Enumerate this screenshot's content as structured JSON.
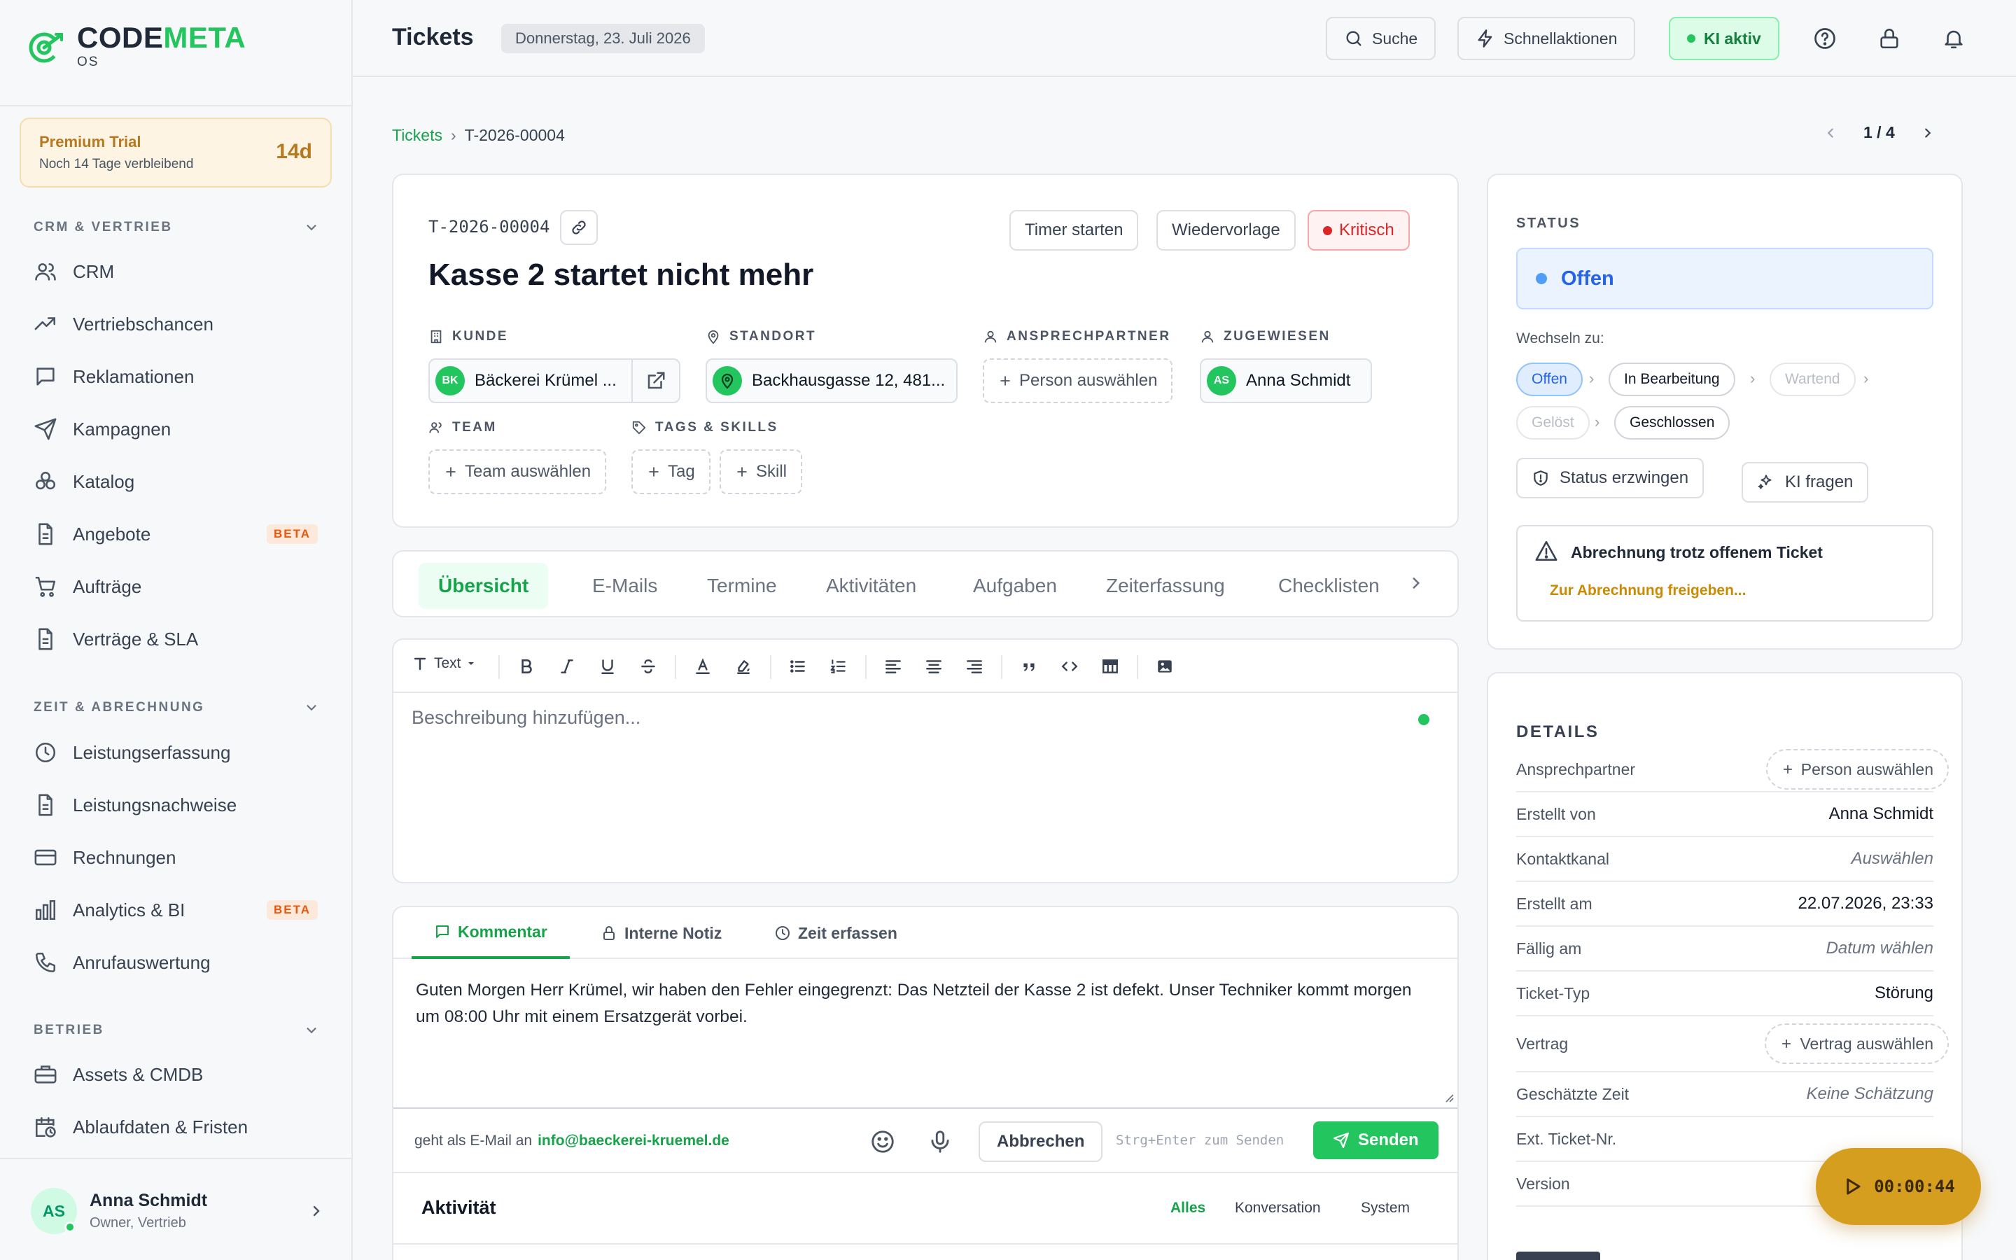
{
  "brand": {
    "name_a": "CODE",
    "name_b": "META",
    "sub": "OS"
  },
  "trial": {
    "title": "Premium Trial",
    "subtitle": "Noch 14 Tage verbleibend",
    "days": "14d"
  },
  "sidebar": {
    "sections": [
      {
        "label": "CRM & VERTRIEB"
      },
      {
        "label": "ZEIT & ABRECHNUNG"
      },
      {
        "label": "BETRIEB"
      }
    ],
    "items": [
      {
        "label": "CRM",
        "icon": "users-icon"
      },
      {
        "label": "Vertriebschancen",
        "icon": "trending-up-icon"
      },
      {
        "label": "Reklamationen",
        "icon": "message-square-icon"
      },
      {
        "label": "Kampagnen",
        "icon": "send-icon"
      },
      {
        "label": "Katalog",
        "icon": "boxes-icon"
      },
      {
        "label": "Angebote",
        "icon": "file-text-icon",
        "badge": "BETA"
      },
      {
        "label": "Aufträge",
        "icon": "cart-icon"
      },
      {
        "label": "Verträge & SLA",
        "icon": "file-text-icon"
      },
      {
        "label": "Leistungserfassung",
        "icon": "clock-icon"
      },
      {
        "label": "Leistungsnachweise",
        "icon": "file-text-icon"
      },
      {
        "label": "Rechnungen",
        "icon": "credit-card-icon"
      },
      {
        "label": "Analytics & BI",
        "icon": "bar-chart-icon",
        "badge": "BETA"
      },
      {
        "label": "Anrufauswertung",
        "icon": "phone-icon"
      },
      {
        "label": "Assets & CMDB",
        "icon": "briefcase-icon"
      },
      {
        "label": "Ablaufdaten & Fristen",
        "icon": "calendar-clock-icon"
      }
    ],
    "user": {
      "initials": "AS",
      "name": "Anna Schmidt",
      "role": "Owner, Vertrieb"
    }
  },
  "topbar": {
    "title": "Tickets",
    "date": "Donnerstag, 23. Juli 2026",
    "search": "Suche",
    "quick_actions": "Schnellaktionen",
    "ai_status": "KI aktiv"
  },
  "breadcrumb": {
    "root": "Tickets",
    "sep": "›",
    "current": "T-2026-00004"
  },
  "pager": {
    "text": "1 / 4"
  },
  "ticket": {
    "id": "T-2026-00004",
    "title": "Kasse 2 startet nicht mehr",
    "timer_button": "Timer starten",
    "followup_button": "Wiedervorlage",
    "priority": "Kritisch",
    "fields": {
      "customer_label": "KUNDE",
      "customer_initials": "BK",
      "customer": "Bäckerei Krümel ...",
      "location_label": "STANDORT",
      "location": "Backhausgasse 12, 481...",
      "contact_label": "ANSPRECHPARTNER",
      "contact_placeholder": "Person auswählen",
      "assigned_label": "ZUGEWIESEN",
      "assigned_initials": "AS",
      "assigned": "Anna Schmidt",
      "team_label": "TEAM",
      "team_placeholder": "Team auswählen",
      "tags_label": "TAGS & SKILLS",
      "tag_button": "Tag",
      "skill_button": "Skill"
    }
  },
  "tabs": [
    "Übersicht",
    "E-Mails",
    "Termine",
    "Aktivitäten",
    "Aufgaben",
    "Zeiterfassung",
    "Checklisten"
  ],
  "editor": {
    "text_style": "Text",
    "placeholder": "Beschreibung hinzufügen..."
  },
  "comment": {
    "tabs": [
      "Kommentar",
      "Interne Notiz",
      "Zeit erfassen"
    ],
    "text": "Guten Morgen Herr Krümel, wir haben den Fehler eingegrenzt: Das Netzteil der Kasse 2 ist defekt. Unser Techniker kommt morgen um 08:00 Uhr mit einem Ersatzgerät vorbei.",
    "send_as_prefix": "geht als E-Mail an",
    "send_as_email": "info@baeckerei-kruemel.de",
    "cancel": "Abbrechen",
    "hint": "Strg+Enter zum Senden",
    "send": "Senden"
  },
  "activity": {
    "title": "Aktivität",
    "filters": [
      "Alles",
      "Konversation",
      "System"
    ]
  },
  "status": {
    "label": "STATUS",
    "current": "Offen",
    "switch_label": "Wechseln zu:",
    "options": [
      "Offen",
      "In Bearbeitung",
      "Wartend",
      "Gelöst",
      "Geschlossen"
    ],
    "force_button": "Status erzwingen",
    "ai_button": "KI fragen",
    "warning_title": "Abrechnung trotz offenem Ticket",
    "warning_link": "Zur Abrechnung freigeben..."
  },
  "details": {
    "label": "DETAILS",
    "rows": [
      {
        "label": "Ansprechpartner",
        "value": "Person auswählen"
      },
      {
        "label": "Erstellt von",
        "value": "Anna Schmidt"
      },
      {
        "label": "Kontaktkanal",
        "value": "Auswählen"
      },
      {
        "label": "Erstellt am",
        "value": "22.07.2026, 23:33"
      },
      {
        "label": "Fällig am",
        "value": "Datum wählen"
      },
      {
        "label": "Ticket-Typ",
        "value": "Störung"
      },
      {
        "label": "Vertrag",
        "value": "Vertrag auswählen"
      },
      {
        "label": "Geschätzte Zeit",
        "value": "Keine Schätzung"
      },
      {
        "label": "Ext. Ticket-Nr.",
        "value": ""
      },
      {
        "label": "Version",
        "value": ""
      }
    ]
  },
  "timer": {
    "value": "00:00:44"
  },
  "colors": {
    "accent": "#22c55e",
    "accent_dark": "#16a34a",
    "critical": "#dc2626",
    "trial": "#b7791f",
    "timer": "#d69e1e",
    "status_blue": "#2563eb"
  }
}
